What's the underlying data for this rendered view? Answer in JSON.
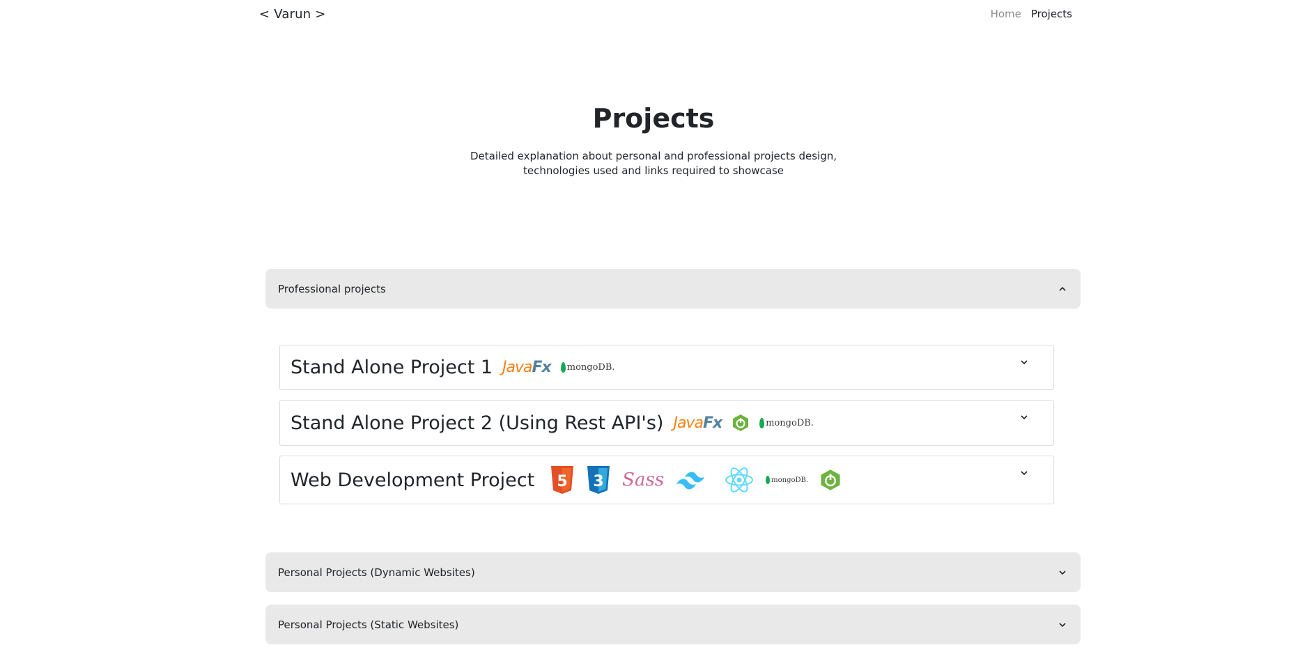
{
  "nav": {
    "brand": "< Varun >",
    "links": [
      {
        "label": "Home",
        "active": false
      },
      {
        "label": "Projects",
        "active": true
      }
    ]
  },
  "hero": {
    "title": "Projects",
    "subtitle_line1": "Detailed explanation about personal and professional projects design,",
    "subtitle_line2": "technologies used and links required to showcase"
  },
  "sections": [
    {
      "label": "Professional projects",
      "expanded": true
    },
    {
      "label": "Personal Projects (Dynamic Websites)",
      "expanded": false
    },
    {
      "label": "Personal Projects (Static Websites)",
      "expanded": false
    }
  ],
  "professional_projects": [
    {
      "title": "Stand Alone Project 1",
      "tech": [
        "javafx-logo",
        "mongodb-logo"
      ]
    },
    {
      "title": "Stand Alone Project 2 (Using Rest API's)",
      "tech": [
        "javafx-logo",
        "spring-boot-logo",
        "mongodb-logo"
      ]
    },
    {
      "title": "Web Development Project",
      "tech": [
        "html5-logo",
        "css3-logo",
        "sass-logo",
        "tailwind-logo",
        "react-logo",
        "mongodb-logo",
        "spring-boot-logo"
      ]
    }
  ],
  "logos": {
    "javafx_a": "Java",
    "javafx_b": "Fx",
    "mongodb": "mongoDB.",
    "html5": "5",
    "css3": "3",
    "sass": "Sass"
  },
  "colors": {
    "section_bg": "#e9e9e9",
    "javafx_orange": "#f58219",
    "javafx_blue": "#5382a1",
    "mongo_green": "#13aa52",
    "html5_orange": "#e34f26",
    "css3_blue": "#1572b6",
    "sass_pink": "#cd6799",
    "tailwind_cyan": "#38bdf8",
    "react_cyan": "#61dafb",
    "spring_green": "#6db33f"
  }
}
